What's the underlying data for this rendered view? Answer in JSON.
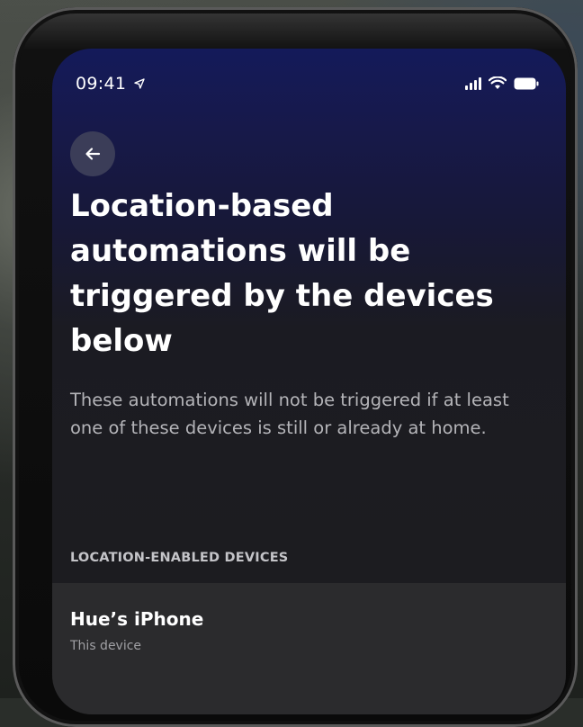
{
  "status_bar": {
    "time": "09:41",
    "location_icon": "location-arrow-icon",
    "signal_icon": "cellular-signal-icon",
    "wifi_icon": "wifi-icon",
    "battery_icon": "battery-icon"
  },
  "nav": {
    "back_icon": "arrow-left-icon"
  },
  "page": {
    "title": "Location-based automations will be triggered by the devices below",
    "subtitle": "These automations will not be triggered if at least one of these devices is still or already at home."
  },
  "devices_section": {
    "label": "LOCATION-ENABLED DEVICES",
    "items": [
      {
        "name": "Hue’s iPhone",
        "detail": "This device"
      }
    ]
  },
  "colors": {
    "screen_top": "#141a5a",
    "screen_bottom": "#1d1d1f",
    "row_bg": "#2b2b2d",
    "back_button_bg": "#3b3d58"
  }
}
